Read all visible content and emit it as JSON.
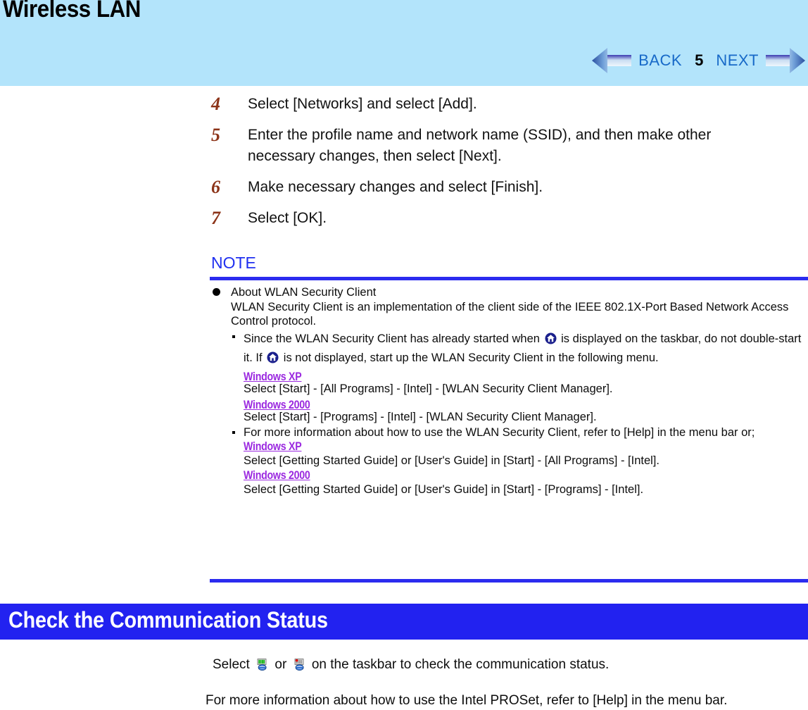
{
  "header": {
    "title": "Wireless LAN",
    "background_color": "#b3e4fb",
    "nav": {
      "back_label": "BACK",
      "next_label": "NEXT",
      "page_number": "5",
      "back_icon": "left-arrow-icon",
      "next_icon": "right-arrow-icon",
      "link_color": "#1769c8"
    }
  },
  "steps": [
    {
      "number": "4",
      "text": "Select [Networks] and select [Add]."
    },
    {
      "number": "5",
      "text": "Enter the profile name and network name (SSID), and then make other necessary changes, then select [Next]."
    },
    {
      "number": "6",
      "text": "Make necessary changes and select [Finish]."
    },
    {
      "number": "7",
      "text": "Select [OK]."
    }
  ],
  "note": {
    "label": "NOTE",
    "label_color": "#2030f0",
    "rule_color": "#2b2bef",
    "heading": "About WLAN Security Client",
    "heading_body": "WLAN Security Client is an implementation of the client side of the IEEE 802.1X-Port Based Network Access Control protocol.",
    "bullets": [
      {
        "text_part1": "Since the WLAN Security Client has already started when",
        "icon1": "wlan-security-client-icon",
        "text_part2": "is displayed on the taskbar, do not double-start it.  If",
        "icon2": "wlan-security-client-icon",
        "text_part3": "is not displayed, start up the WLAN Security Client in the following menu.",
        "os_entries": [
          {
            "os": "Windows XP",
            "instruction": "Select [Start] - [All Programs] - [Intel] - [WLAN Security Client Manager]."
          },
          {
            "os": "Windows 2000",
            "instruction": "Select [Start] - [Programs] - [Intel] - [WLAN Security Client Manager]."
          }
        ]
      },
      {
        "text_part1": "For more information about how to use the WLAN Security Client, refer to [Help] in the menu bar or;",
        "os_entries": [
          {
            "os": "Windows XP",
            "instruction": "Select [Getting Started Guide] or [User's Guide] in [Start] - [All Programs] - [Intel]."
          },
          {
            "os": "Windows 2000",
            "instruction": "Select [Getting Started Guide] or [User's Guide] in [Start] - [Programs] - [Intel]."
          }
        ]
      }
    ],
    "os_tag_color": "#9b29e0"
  },
  "section": {
    "title": "Check the Communication Status",
    "banner_color": "#2222f0",
    "title_color": "#ffffff"
  },
  "footer": {
    "status_text_part1": "Select",
    "status_icon1": "wireless-signal-connected-icon",
    "status_text_or": "or",
    "status_icon2": "wireless-signal-disconnected-icon",
    "status_text_part2": "on the taskbar to check the communication status.",
    "proset_text": "For more information about how to use the Intel PROSet, refer to [Help] in the menu bar."
  }
}
